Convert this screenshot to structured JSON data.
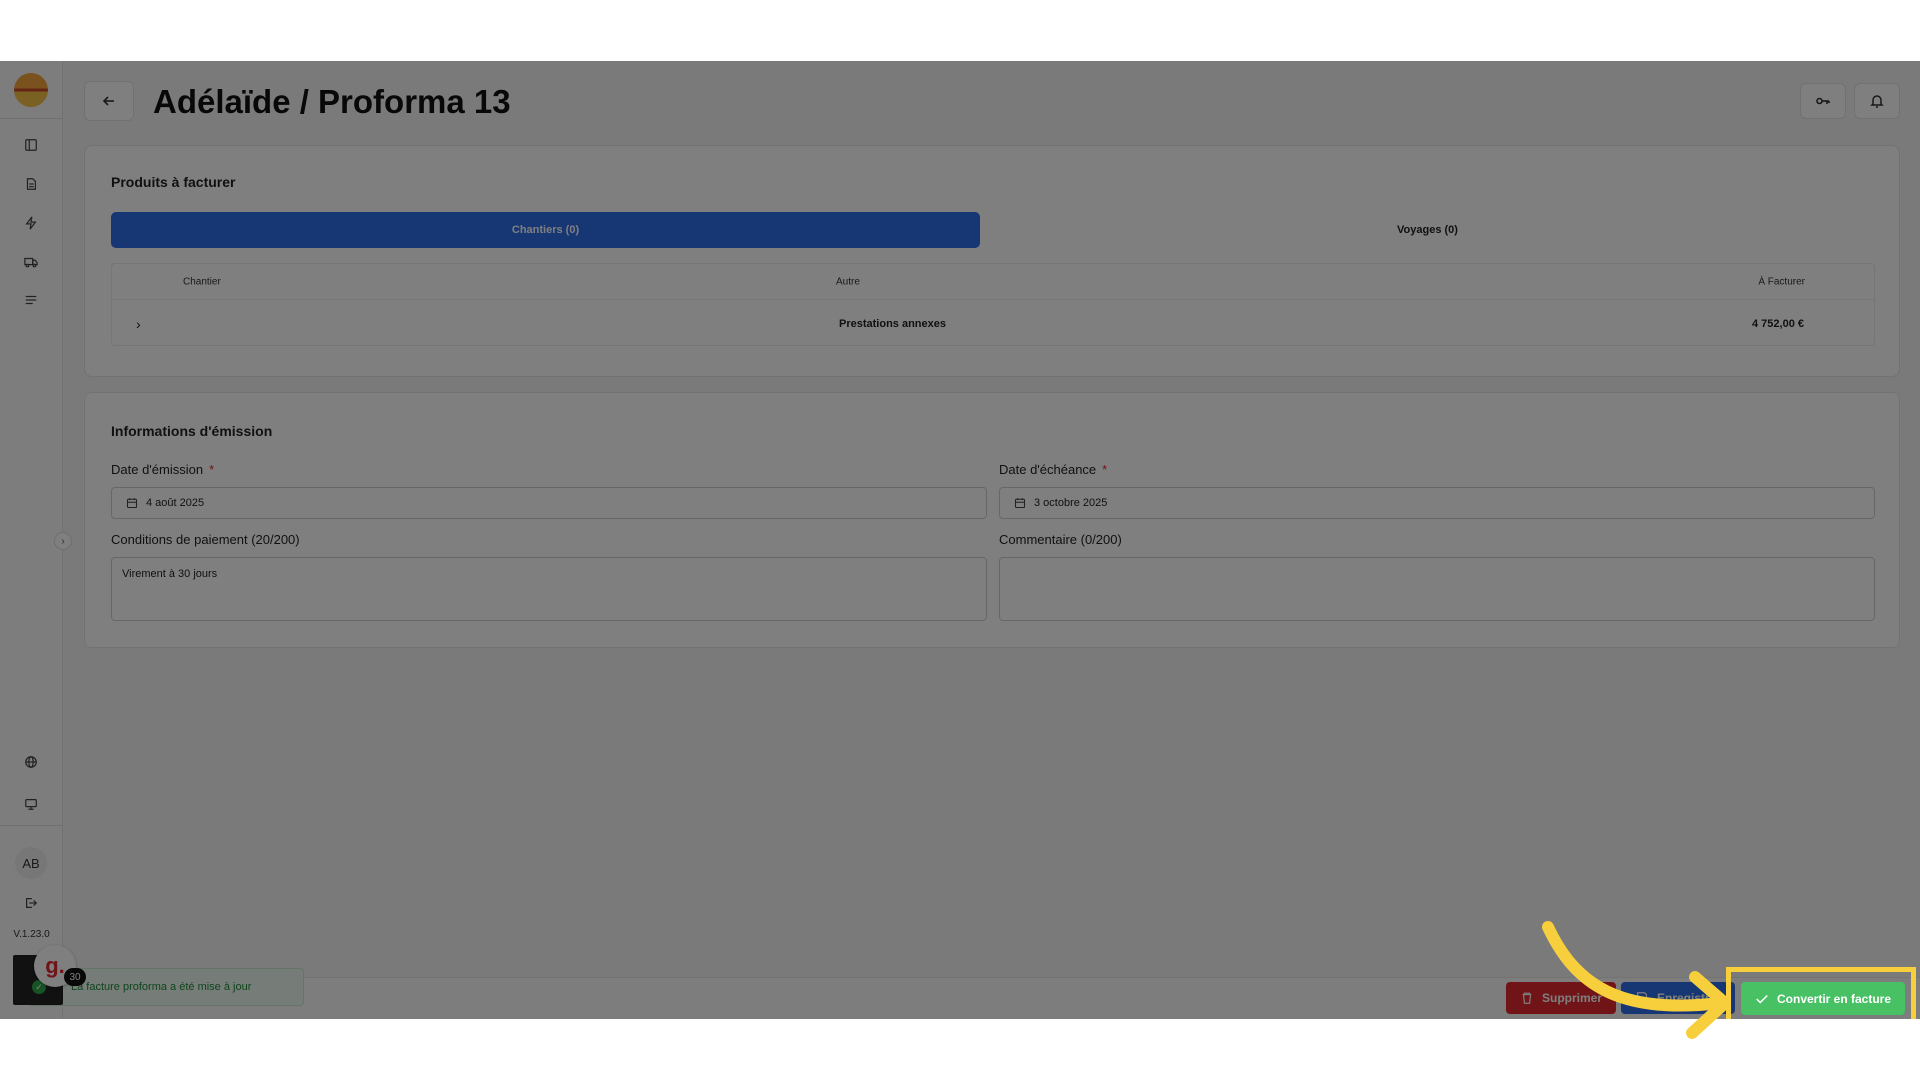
{
  "page": {
    "title": "Adélaïde / Proforma 13"
  },
  "sidebar": {
    "avatar_initials": "AB",
    "version": "V.1.23.0"
  },
  "products": {
    "section_title": "Produits à facturer",
    "tabs": [
      {
        "label": "Chantiers (0)",
        "active": true
      },
      {
        "label": "Voyages (0)",
        "active": false
      }
    ],
    "table": {
      "headers": {
        "chantier": "Chantier",
        "autre": "Autre",
        "a_facturer": "À Facturer"
      },
      "rows": [
        {
          "chantier": "",
          "autre": "Prestations annexes",
          "a_facturer": "4 752,00 €"
        }
      ]
    }
  },
  "emission": {
    "section_title": "Informations d'émission",
    "date_emission": {
      "label": "Date d'émission",
      "required": "*",
      "value": "4 août 2025"
    },
    "date_echeance": {
      "label": "Date d'échéance",
      "required": "*",
      "value": "3 octobre 2025"
    },
    "conditions": {
      "label": "Conditions de paiement (20/200)",
      "value": "Virement à 30 jours"
    },
    "commentaire": {
      "label": "Commentaire (0/200)",
      "value": ""
    }
  },
  "toast": {
    "message": "La facture proforma a été mise à jour"
  },
  "widget": {
    "badge": "30",
    "letter": "g."
  },
  "footer": {
    "delete_label": "Supprimer",
    "save_label": "Enregistrer",
    "convert_label": "Convertir en facture"
  },
  "colors": {
    "primary": "#2c6ee6",
    "danger": "#e0282e",
    "success": "#47c163",
    "highlight": "#f7cf3d"
  }
}
